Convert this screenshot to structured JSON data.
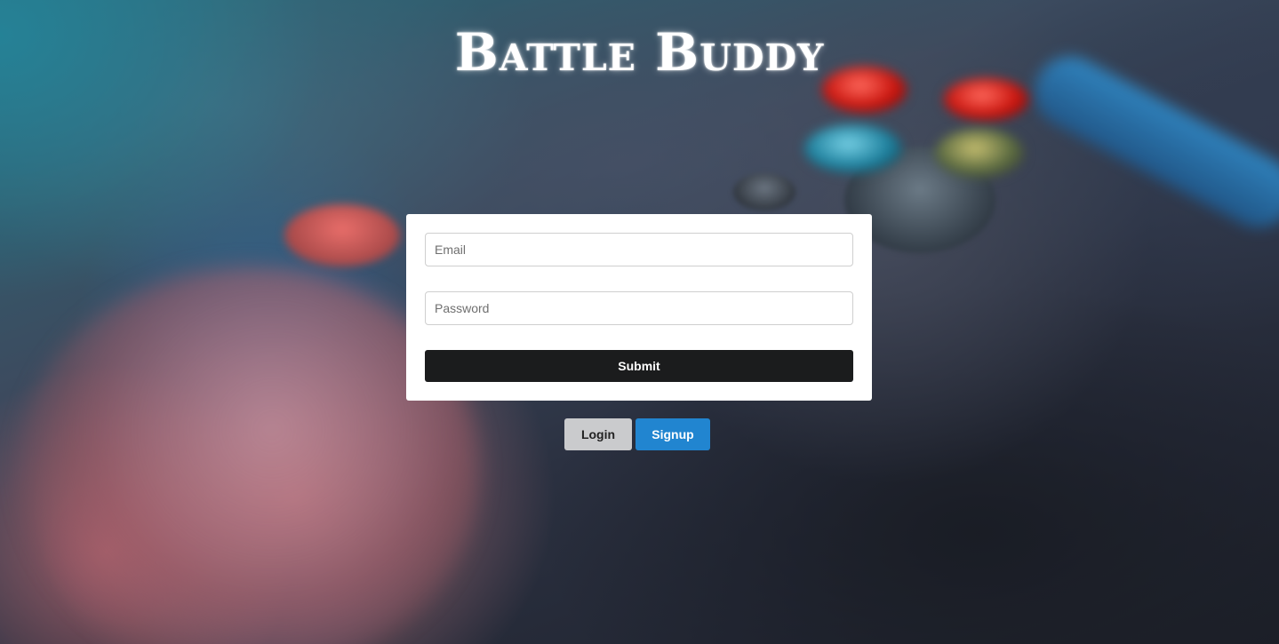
{
  "app": {
    "logo_text": "Battle Buddy"
  },
  "form": {
    "email": {
      "placeholder": "Email",
      "value": ""
    },
    "password": {
      "placeholder": "Password",
      "value": ""
    },
    "submit_label": "Submit"
  },
  "toggle": {
    "login_label": "Login",
    "signup_label": "Signup",
    "active": "signup"
  },
  "colors": {
    "submit_bg": "#1b1c1d",
    "login_bg": "#cacbcd",
    "signup_bg": "#2185d0",
    "card_bg": "#ffffff"
  }
}
